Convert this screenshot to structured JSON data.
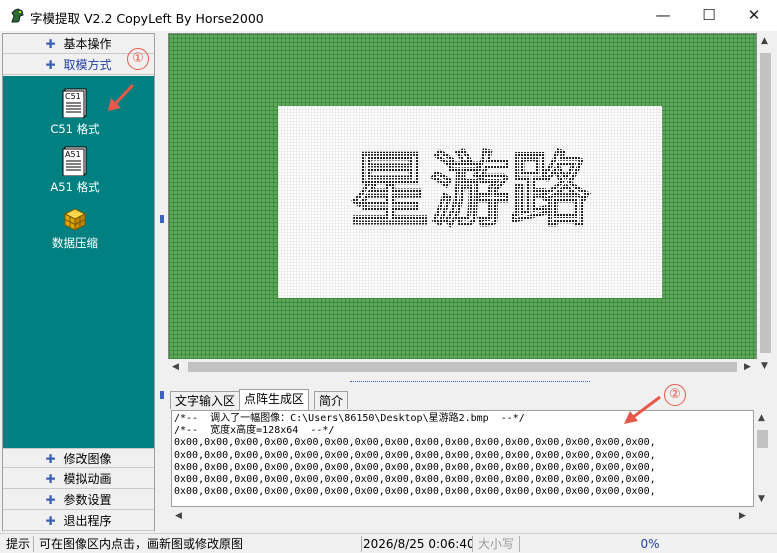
{
  "window": {
    "title": "字模提取 V2.2  CopyLeft By Horse2000",
    "minimize": "—",
    "maximize": "☐",
    "close": "✕"
  },
  "sidebar": {
    "top_items": [
      {
        "label": "基本操作"
      },
      {
        "label": "取模方式"
      }
    ],
    "tools": [
      {
        "label": "C51 格式",
        "icon_text": "C51",
        "icon": "c51-document-icon"
      },
      {
        "label": "A51 格式",
        "icon_text": "A51",
        "icon": "a51-document-icon"
      },
      {
        "label": "数据压缩",
        "icon": "compress-cube-icon"
      }
    ],
    "bottom_items": [
      {
        "label": "修改图像"
      },
      {
        "label": "模拟动画"
      },
      {
        "label": "参数设置"
      },
      {
        "label": "退出程序"
      }
    ]
  },
  "annotations": {
    "marker1": "①",
    "marker2": "②",
    "color": "#e85848"
  },
  "canvas": {
    "image_text": "星游路",
    "grid_color": "#3c8c3c",
    "background_color": "#60a860"
  },
  "tabs": [
    {
      "label": "文字输入区",
      "active": false
    },
    {
      "label": "点阵生成区",
      "active": true
    },
    {
      "label": "简介",
      "active": false
    }
  ],
  "output": {
    "lines": [
      "/*--  调入了一幅图像：C:\\Users\\86150\\Desktop\\星游路2.bmp  --*/",
      "/*--  宽度x高度=128x64  --*/",
      "0x00,0x00,0x00,0x00,0x00,0x00,0x00,0x00,0x00,0x00,0x00,0x00,0x00,0x00,0x00,0x00,",
      "0x00,0x00,0x00,0x00,0x00,0x00,0x00,0x00,0x00,0x00,0x00,0x00,0x00,0x00,0x00,0x00,",
      "0x00,0x00,0x00,0x00,0x00,0x00,0x00,0x00,0x00,0x00,0x00,0x00,0x00,0x00,0x00,0x00,",
      "0x00,0x00,0x00,0x00,0x00,0x00,0x00,0x00,0x00,0x00,0x00,0x00,0x00,0x00,0x00,0x00,",
      "0x00,0x00,0x00,0x00,0x00,0x00,0x00,0x00,0x00,0x00,0x00,0x00,0x00,0x00,0x00,0x00,"
    ]
  },
  "statusbar": {
    "label": "提示",
    "hint": "可在图像区内点击，画新图或修改原图",
    "datetime": "2026/8/25 0:06:40",
    "case": "大小写",
    "progress": "0%"
  }
}
